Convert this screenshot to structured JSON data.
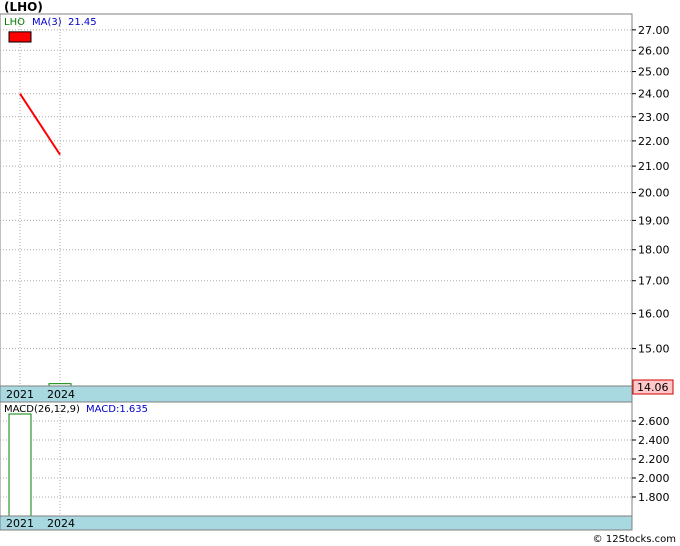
{
  "title": "(LHO)",
  "watermark": "© 12Stocks.com",
  "colors": {
    "grid": "#aaaaaa",
    "axisband": "#a8d8e0",
    "candle_down": "#ff0000",
    "candle_up": "#008000",
    "ma_line": "#ff0000",
    "legend_ticker": "#008000",
    "legend_ma": "#0000cc",
    "legend_macd": "#0000cc",
    "last_price_box": "#ffc8c8"
  },
  "chart_data": [
    {
      "type": "candlestick",
      "legend": {
        "ticker": "LHO",
        "ma_label": "MA(3)",
        "ma_value": "21.45"
      },
      "x": [
        "2021",
        "2024"
      ],
      "ohlc": [
        {
          "x": "2021",
          "open": 26.9,
          "high": 26.9,
          "low": 26.4,
          "close": 26.4
        },
        {
          "x": "2024",
          "open": 14.06,
          "high": 14.06,
          "low": 14.0,
          "close": 14.06
        }
      ],
      "ma_series": {
        "name": "MA(3)",
        "points": [
          {
            "x": "2021",
            "y": 24.0
          },
          {
            "x": "2024",
            "y": 21.45
          }
        ]
      },
      "yticks": [
        "27.00",
        "26.00",
        "25.00",
        "24.00",
        "23.00",
        "22.00",
        "21.00",
        "20.00",
        "19.00",
        "18.00",
        "17.00",
        "16.00",
        "15.00"
      ],
      "ytick_values": [
        27,
        26,
        25,
        24,
        23,
        22,
        21,
        20,
        19,
        18,
        17,
        16,
        15
      ],
      "last_price": "14.06",
      "scale": "log",
      "ylim": [
        14.0,
        27.8
      ],
      "grid": true
    },
    {
      "type": "bar",
      "legend": {
        "label": "MACD(26,12,9)",
        "macd_label": "MACD:1.635"
      },
      "x": [
        "2021",
        "2024"
      ],
      "values": [
        2.75,
        null
      ],
      "yticks": [
        "2.600",
        "2.400",
        "2.200",
        "2.000",
        "1.800"
      ],
      "ytick_values": [
        2.6,
        2.4,
        2.2,
        2.0,
        1.8
      ],
      "ylim": [
        1.6,
        2.8
      ],
      "grid": true
    }
  ]
}
